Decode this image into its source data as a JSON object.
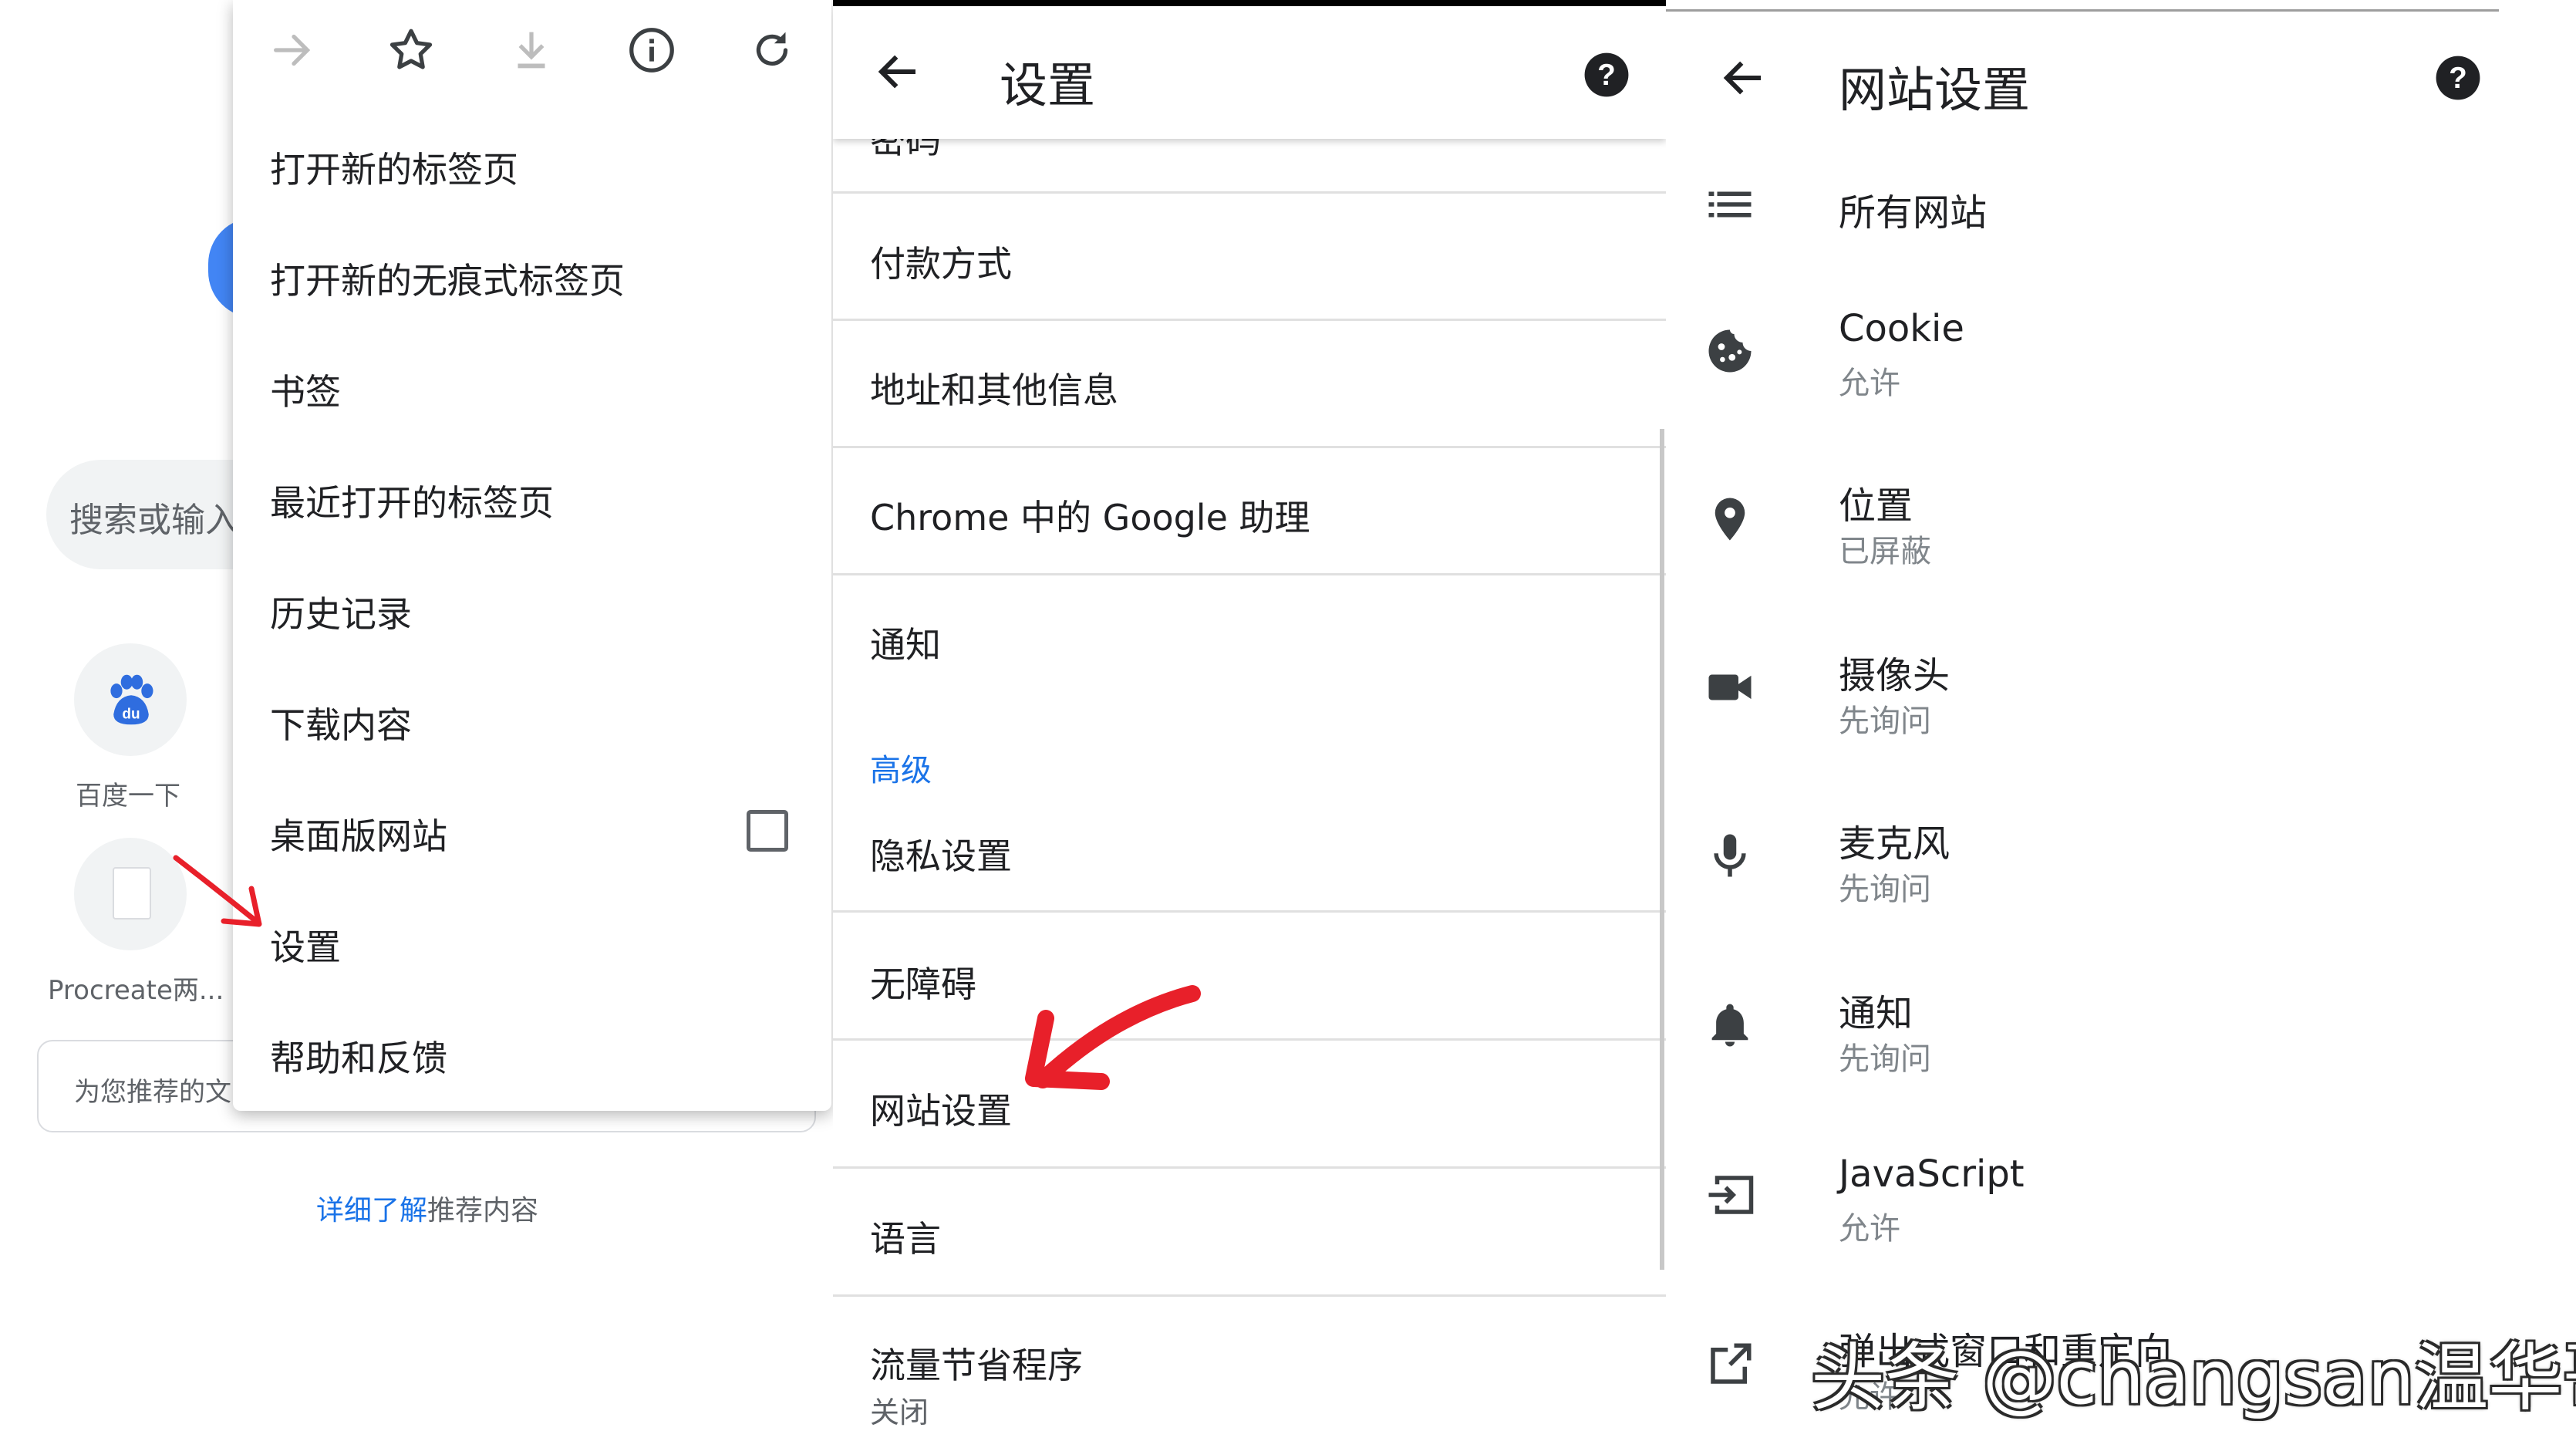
{
  "left": {
    "search_placeholder": "搜索或输入",
    "tiles": [
      {
        "label": "百度一下",
        "icon": "baidu-paw-icon"
      },
      {
        "label": "Procreate两...",
        "icon": "document-icon"
      }
    ],
    "recommend_card_text": "为您推荐的文",
    "learn_more_link": "详细了解",
    "learn_more_rest": "推荐内容"
  },
  "menu": {
    "toolbar_icons": [
      "forward-arrow-icon",
      "bookmark-star-icon",
      "download-icon",
      "info-icon",
      "refresh-icon"
    ],
    "items": [
      {
        "label": "打开新的标签页"
      },
      {
        "label": "打开新的无痕式标签页"
      },
      {
        "label": "书签"
      },
      {
        "label": "最近打开的标签页"
      },
      {
        "label": "历史记录"
      },
      {
        "label": "下载内容"
      },
      {
        "label": "桌面版网站",
        "checkbox": false
      },
      {
        "label": "设置"
      },
      {
        "label": "帮助和反馈"
      }
    ]
  },
  "settings": {
    "title": "设置",
    "partial_row": "密码",
    "rows": [
      {
        "label": "付款方式"
      },
      {
        "label": "地址和其他信息"
      },
      {
        "label": "Chrome 中的 Google 助理"
      },
      {
        "label": "通知"
      }
    ],
    "advanced_header": "高级",
    "advanced_rows": [
      {
        "label": "隐私设置"
      },
      {
        "label": "无障碍"
      },
      {
        "label": "网站设置"
      },
      {
        "label": "语言"
      },
      {
        "label": "流量节省程序",
        "sub": "关闭"
      }
    ]
  },
  "site_settings": {
    "title": "网站设置",
    "items": [
      {
        "label": "所有网站",
        "icon": "list-icon"
      },
      {
        "label": "Cookie",
        "sub": "允许",
        "icon": "cookie-icon"
      },
      {
        "label": "位置",
        "sub": "已屏蔽",
        "icon": "location-pin-icon"
      },
      {
        "label": "摄像头",
        "sub": "先询问",
        "icon": "camera-icon"
      },
      {
        "label": "麦克风",
        "sub": "先询问",
        "icon": "microphone-icon"
      },
      {
        "label": "通知",
        "sub": "先询问",
        "icon": "bell-icon"
      },
      {
        "label": "JavaScript",
        "sub": "允许",
        "icon": "javascript-icon"
      },
      {
        "label": "弹出式窗口和重定向",
        "sub": "允许",
        "icon": "open-in-new-icon"
      }
    ]
  },
  "watermark": "头条 @changsan温华哥",
  "colors": {
    "accent": "#1a73e8",
    "annotation": "#e8202a",
    "google_blue": "#4285f4"
  }
}
